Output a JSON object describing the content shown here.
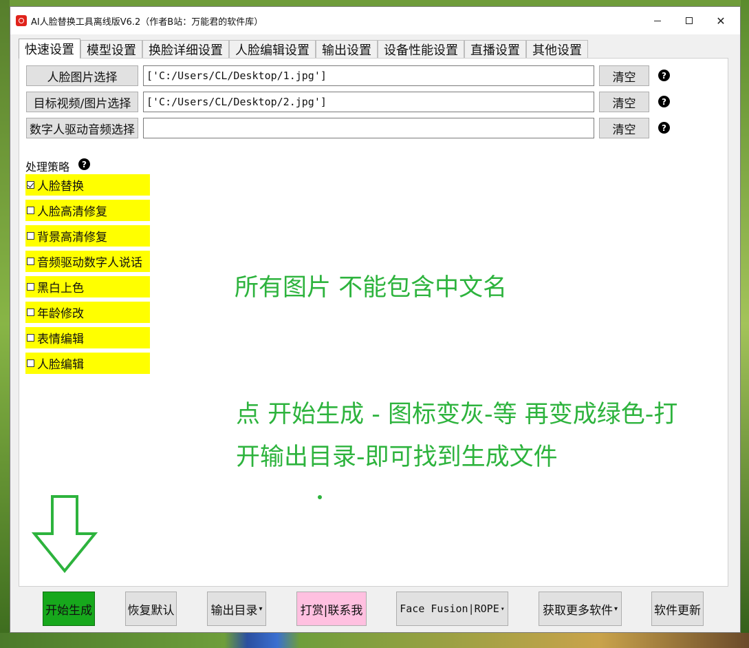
{
  "window": {
    "title": "AI人脸替换工具离线版V6.2（作者B站：万能君的软件库）"
  },
  "tabs": [
    {
      "label": "快速设置"
    },
    {
      "label": "模型设置"
    },
    {
      "label": "换脸详细设置"
    },
    {
      "label": "人脸编辑设置"
    },
    {
      "label": "输出设置"
    },
    {
      "label": "设备性能设置"
    },
    {
      "label": "直播设置"
    },
    {
      "label": "其他设置"
    }
  ],
  "inputs": {
    "face_image": {
      "button": "人脸图片选择",
      "value": "['C:/Users/CL/Desktop/1.jpg']",
      "clear": "清空"
    },
    "target_media": {
      "button": "目标视频/图片选择",
      "value": "['C:/Users/CL/Desktop/2.jpg']",
      "clear": "清空"
    },
    "driving_audio": {
      "button": "数字人驱动音频选择",
      "value": "",
      "clear": "清空"
    }
  },
  "help_glyph": "?",
  "strategy": {
    "label": "处理策略",
    "options": [
      {
        "label": "人脸替换",
        "checked": true
      },
      {
        "label": "人脸高清修复",
        "checked": false
      },
      {
        "label": "背景高清修复",
        "checked": false
      },
      {
        "label": "音频驱动数字人说话",
        "checked": false
      },
      {
        "label": "黑白上色",
        "checked": false
      },
      {
        "label": "年龄修改",
        "checked": false
      },
      {
        "label": "表情编辑",
        "checked": false
      },
      {
        "label": "人脸编辑",
        "checked": false
      }
    ]
  },
  "annotations": {
    "note1": "所有图片 不能包含中文名",
    "note2_line1": "点 开始生成 - 图标变灰-等 再变成绿色-打",
    "note2_line2": "开输出目录-即可找到生成文件"
  },
  "bottom_buttons": {
    "start": "开始生成",
    "reset": "恢复默认",
    "output_dir": "输出目录",
    "donate": "打赏|联系我",
    "engine": "Face Fusion|ROPE",
    "more_software": "获取更多软件",
    "update": "软件更新"
  },
  "colors": {
    "highlight_yellow": "#ffff00",
    "note_green": "#2db33d",
    "start_green": "#17a81c",
    "donate_pink": "#ffc0e0"
  },
  "icons": {
    "minimize": "minimize-icon",
    "maximize": "maximize-icon",
    "close": "close-icon",
    "help": "help-icon",
    "down_arrow": "down-arrow-icon"
  }
}
